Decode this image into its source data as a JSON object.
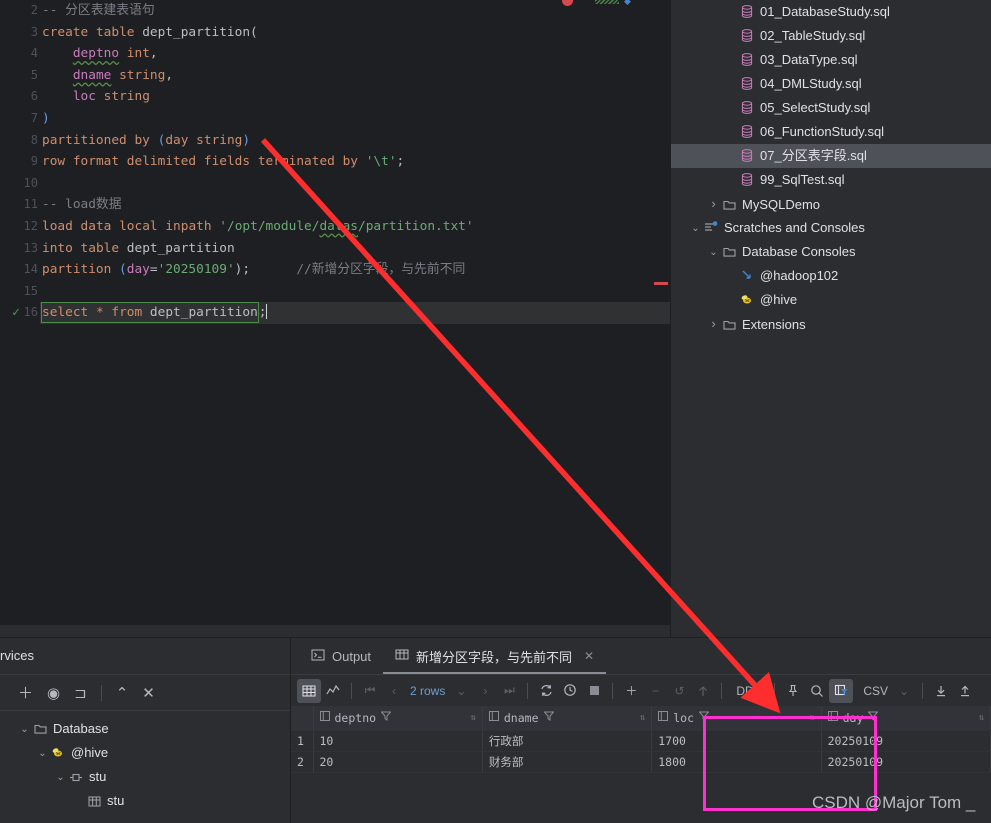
{
  "editor": {
    "lines": [
      {
        "num": "2",
        "segs": [
          {
            "t": "-- 分区表建表语句",
            "c": "cmt"
          }
        ]
      },
      {
        "num": "3",
        "segs": [
          {
            "t": "create",
            "c": "kw"
          },
          {
            "t": " ",
            "c": "punct"
          },
          {
            "t": "table",
            "c": "kw"
          },
          {
            "t": " dept_partition(",
            "c": "punct"
          }
        ]
      },
      {
        "num": "4",
        "segs": [
          {
            "t": "    ",
            "c": "punct"
          },
          {
            "t": "deptno",
            "c": "field wavy"
          },
          {
            "t": " ",
            "c": "punct"
          },
          {
            "t": "int",
            "c": "kw"
          },
          {
            "t": ",",
            "c": "punct"
          }
        ]
      },
      {
        "num": "5",
        "segs": [
          {
            "t": "    ",
            "c": "punct"
          },
          {
            "t": "dname",
            "c": "field wavy"
          },
          {
            "t": " ",
            "c": "punct"
          },
          {
            "t": "string",
            "c": "kw"
          },
          {
            "t": ",",
            "c": "punct"
          }
        ]
      },
      {
        "num": "6",
        "segs": [
          {
            "t": "    ",
            "c": "punct"
          },
          {
            "t": "loc",
            "c": "field"
          },
          {
            "t": " ",
            "c": "punct"
          },
          {
            "t": "string",
            "c": "kw"
          }
        ]
      },
      {
        "num": "7",
        "segs": [
          {
            "t": ")",
            "c": "paren"
          }
        ]
      },
      {
        "num": "8",
        "segs": [
          {
            "t": "partitioned",
            "c": "kw"
          },
          {
            "t": " ",
            "c": "punct"
          },
          {
            "t": "by",
            "c": "kw"
          },
          {
            "t": " (",
            "c": "paren"
          },
          {
            "t": "day",
            "c": "kw"
          },
          {
            "t": " ",
            "c": "punct"
          },
          {
            "t": "string",
            "c": "kw"
          },
          {
            "t": ")",
            "c": "paren"
          }
        ]
      },
      {
        "num": "9",
        "segs": [
          {
            "t": "row",
            "c": "kw"
          },
          {
            "t": " ",
            "c": "punct"
          },
          {
            "t": "format",
            "c": "kw"
          },
          {
            "t": " ",
            "c": "punct"
          },
          {
            "t": "delimited",
            "c": "kw"
          },
          {
            "t": " ",
            "c": "punct"
          },
          {
            "t": "fields",
            "c": "kw"
          },
          {
            "t": " ",
            "c": "punct"
          },
          {
            "t": "terminated",
            "c": "kw"
          },
          {
            "t": " ",
            "c": "punct"
          },
          {
            "t": "by",
            "c": "kw"
          },
          {
            "t": " ",
            "c": "punct"
          },
          {
            "t": "'\\t'",
            "c": "str"
          },
          {
            "t": ";",
            "c": "punct"
          }
        ]
      },
      {
        "num": "10",
        "segs": []
      },
      {
        "num": "11",
        "segs": [
          {
            "t": "-- load数据",
            "c": "cmt"
          }
        ]
      },
      {
        "num": "12",
        "segs": [
          {
            "t": "load",
            "c": "kw"
          },
          {
            "t": " ",
            "c": "punct"
          },
          {
            "t": "data",
            "c": "kw"
          },
          {
            "t": " ",
            "c": "punct"
          },
          {
            "t": "local",
            "c": "kw"
          },
          {
            "t": " ",
            "c": "punct"
          },
          {
            "t": "inpath",
            "c": "kw"
          },
          {
            "t": " ",
            "c": "punct"
          },
          {
            "t": "'/opt/module/",
            "c": "str"
          },
          {
            "t": "datas",
            "c": "str wavy"
          },
          {
            "t": "/partition.txt'",
            "c": "str"
          }
        ]
      },
      {
        "num": "13",
        "segs": [
          {
            "t": "into",
            "c": "kw"
          },
          {
            "t": " ",
            "c": "punct"
          },
          {
            "t": "table",
            "c": "kw"
          },
          {
            "t": " dept_partition",
            "c": "punct"
          }
        ]
      },
      {
        "num": "14",
        "segs": [
          {
            "t": "partition",
            "c": "kw"
          },
          {
            "t": " (",
            "c": "paren"
          },
          {
            "t": "day",
            "c": "field"
          },
          {
            "t": "=",
            "c": "punct"
          },
          {
            "t": "'20250109'",
            "c": "str"
          },
          {
            "t": ");",
            "c": "punct"
          },
          {
            "t": "      ",
            "c": "punct"
          },
          {
            "t": "//新增分区字段，与先前不同",
            "c": "cmt"
          }
        ]
      },
      {
        "num": "15",
        "segs": []
      },
      {
        "num": "16",
        "segs": [],
        "selected": true,
        "check": "✓",
        "boxed": [
          {
            "t": "select",
            "c": "kw"
          },
          {
            "t": " ",
            "c": "punct"
          },
          {
            "t": "*",
            "c": "kw"
          },
          {
            "t": " ",
            "c": "punct"
          },
          {
            "t": "from",
            "c": "kw"
          },
          {
            "t": " dept_partition",
            "c": "punct"
          }
        ],
        "after": ";"
      }
    ]
  },
  "project_tree": {
    "items": [
      {
        "label": "01_DatabaseStudy.sql",
        "icon": "sql-file-icon",
        "indent": 3,
        "twisty": "",
        "selected": false
      },
      {
        "label": "02_TableStudy.sql",
        "icon": "sql-file-icon",
        "indent": 3,
        "twisty": "",
        "selected": false
      },
      {
        "label": "03_DataType.sql",
        "icon": "sql-file-icon",
        "indent": 3,
        "twisty": "",
        "selected": false
      },
      {
        "label": "04_DMLStudy.sql",
        "icon": "sql-file-icon",
        "indent": 3,
        "twisty": "",
        "selected": false
      },
      {
        "label": "05_SelectStudy.sql",
        "icon": "sql-file-icon",
        "indent": 3,
        "twisty": "",
        "selected": false
      },
      {
        "label": "06_FunctionStudy.sql",
        "icon": "sql-file-icon",
        "indent": 3,
        "twisty": "",
        "selected": false
      },
      {
        "label": "07_分区表字段.sql",
        "icon": "sql-file-icon",
        "indent": 3,
        "twisty": "",
        "selected": true
      },
      {
        "label": "99_SqlTest.sql",
        "icon": "sql-file-icon",
        "indent": 3,
        "twisty": "",
        "selected": false
      },
      {
        "label": "MySQLDemo",
        "icon": "folder-icon",
        "indent": 2,
        "twisty": "›",
        "selected": false
      },
      {
        "label": "Scratches and Consoles",
        "icon": "scratches-icon",
        "indent": 1,
        "twisty": "⌄",
        "selected": false
      },
      {
        "label": "Database Consoles",
        "icon": "folder-icon",
        "indent": 2,
        "twisty": "⌄",
        "selected": false
      },
      {
        "label": "@hadoop102",
        "icon": "console-icon",
        "indent": 3,
        "twisty": "",
        "selected": false
      },
      {
        "label": "@hive",
        "icon": "hive-bee-icon",
        "indent": 3,
        "twisty": "",
        "selected": false
      },
      {
        "label": "Extensions",
        "icon": "folder-icon",
        "indent": 2,
        "twisty": "›",
        "selected": false
      }
    ]
  },
  "services": {
    "title": "rvices",
    "toolbar": [
      {
        "name": "add-icon",
        "glyph": "＋"
      },
      {
        "name": "eye-icon",
        "glyph": "◉"
      },
      {
        "name": "new-tab-icon",
        "glyph": "⊐"
      },
      {
        "name": "expand-icon",
        "glyph": "⌃"
      },
      {
        "name": "close-all-icon",
        "glyph": "✕"
      }
    ],
    "tree": [
      {
        "label": "Database",
        "icon": "folder-icon",
        "indent": 1,
        "twisty": "⌄"
      },
      {
        "label": "@hive",
        "icon": "hive-bee-icon",
        "indent": 2,
        "twisty": "⌄"
      },
      {
        "label": "stu",
        "icon": "schema-icon",
        "indent": 3,
        "twisty": "⌄"
      },
      {
        "label": "stu",
        "icon": "table-icon",
        "indent": 4,
        "twisty": ""
      }
    ]
  },
  "results": {
    "tabs": [
      {
        "label": "Output",
        "icon": "output-icon",
        "active": false,
        "closable": false
      },
      {
        "label": "新增分区字段，与先前不同",
        "icon": "grid-icon",
        "active": true,
        "closable": true
      }
    ],
    "close_glyph": "✕",
    "toolbar": {
      "grid_view": "grid-view-icon",
      "chart_view": "chart-view-icon",
      "first_page": "⏮",
      "prev_page": "‹",
      "rows_label": "2 rows",
      "rows_chevron": "⌄",
      "next_page": "›",
      "last_page": "⏭",
      "refresh": "refresh-icon",
      "history": "history-icon",
      "stop": "stop-icon",
      "add_row": "＋",
      "remove_row": "−",
      "revert": "↺",
      "submit": "↑",
      "ddl_label": "DDL",
      "pin": "pin-icon",
      "search": "search-icon",
      "filter_toggle": "column-filter-icon",
      "format_label": "CSV",
      "format_chevron": "⌄",
      "download": "download-icon",
      "upload": "upload-icon"
    },
    "columns": [
      {
        "name": "deptno",
        "type": "number"
      },
      {
        "name": "dname",
        "type": "text"
      },
      {
        "name": "loc",
        "type": "number"
      },
      {
        "name": "day",
        "type": "number"
      }
    ],
    "rows": [
      {
        "n": "1",
        "deptno": "10",
        "dname": "行政部",
        "loc": "1700",
        "day": "20250109"
      },
      {
        "n": "2",
        "deptno": "20",
        "dname": "财务部",
        "loc": "1800",
        "day": "20250109"
      }
    ]
  },
  "annotations": {
    "watermark": "CSDN @Major Tom _",
    "arrow_color": "#ff2e2e",
    "highlight_color": "#ff2fd0"
  }
}
